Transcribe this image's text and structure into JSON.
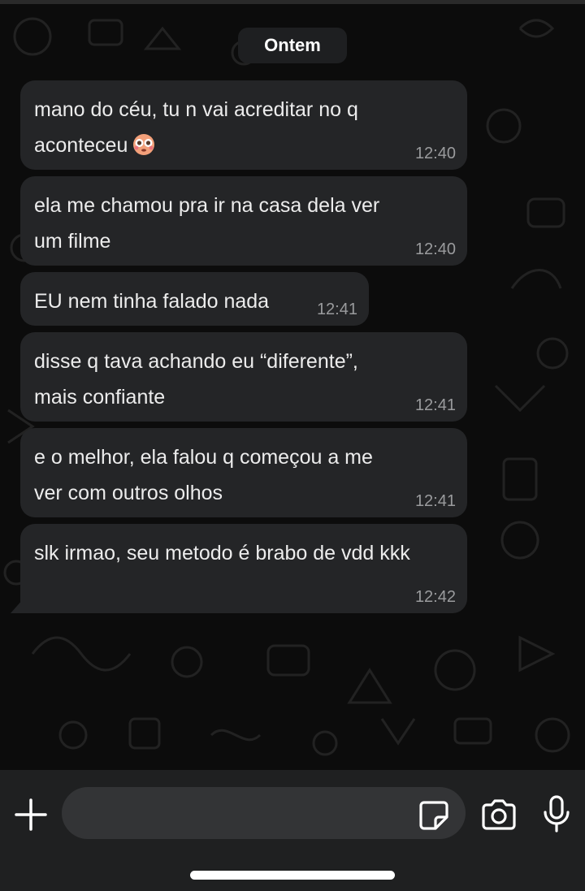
{
  "date_separator": "Ontem",
  "messages": [
    {
      "text": "mano do céu, tu n vai acreditar no q\naconteceu",
      "emoji": "flushed-face-emoji",
      "time": "12:40"
    },
    {
      "text": "ela me chamou pra ir na casa dela ver\num filme",
      "time": "12:40"
    },
    {
      "text": "EU nem tinha falado nada",
      "time": "12:41"
    },
    {
      "text": "disse q tava achando eu “diferente”,\nmais confiante",
      "time": "12:41"
    },
    {
      "text": "e o melhor, ela falou q começou a me\nver com outros olhos",
      "time": "12:41"
    },
    {
      "text": "slk irmao, seu metodo é brabo de vdd kkk",
      "time": "12:42"
    }
  ],
  "composer": {
    "input_value": "",
    "icons": [
      "plus-icon",
      "sticker-icon",
      "camera-icon",
      "microphone-icon"
    ]
  },
  "colors": {
    "background": "#0c0c0c",
    "bubble": "#242527",
    "bar": "#1f2021",
    "input": "#333436",
    "timestamp": "#9a9b9d"
  }
}
